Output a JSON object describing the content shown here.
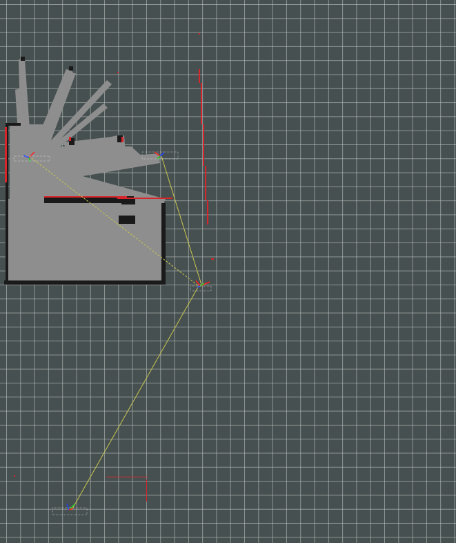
{
  "view": {
    "type": "rviz-3d-view",
    "background_color": "#475050",
    "grid_color": "#c8cdcd"
  },
  "map": {
    "free_color": "#8e8e8e",
    "occupied_color": "#1a1a1a",
    "laser_color": "#d8252a"
  },
  "tf": {
    "link_color": "#c8c850",
    "axis_colors": {
      "x": "#ff2020",
      "y": "#20d020",
      "z": "#2040ff"
    },
    "frames": [
      {
        "name": "frame-a",
        "label": "",
        "icon": "tf-axes-icon"
      },
      {
        "name": "frame-b",
        "label": "",
        "icon": "tf-axes-icon"
      },
      {
        "name": "frame-c",
        "label": "",
        "icon": "tf-axes-icon"
      },
      {
        "name": "frame-d",
        "label": "",
        "icon": "tf-axes-icon"
      }
    ]
  }
}
